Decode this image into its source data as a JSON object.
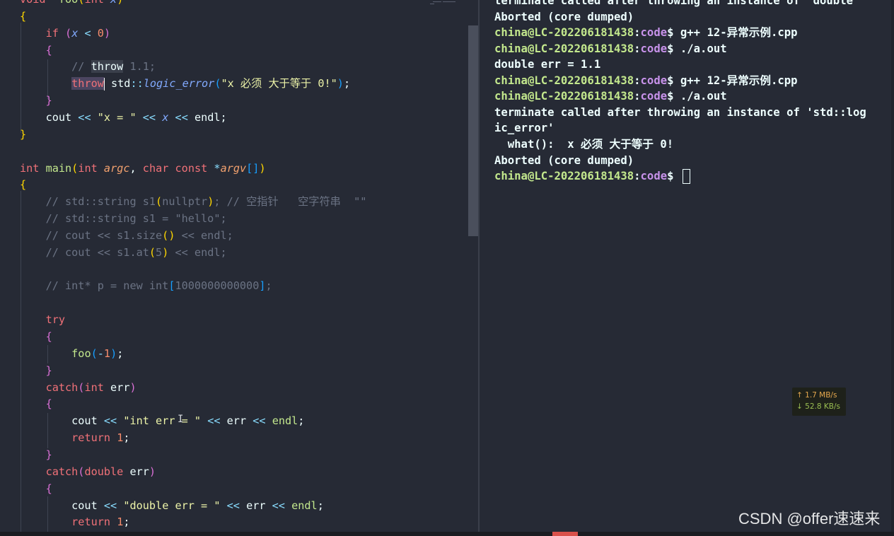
{
  "editor": {
    "lines": [
      {
        "segments": [
          [
            "ty",
            "void"
          ],
          [
            "",
            "  "
          ],
          [
            "fn",
            "foo"
          ],
          [
            "br1",
            "("
          ],
          [
            "ty",
            "int"
          ],
          [
            "",
            ""
          ],
          [
            "it",
            " x"
          ],
          [
            "br1",
            ")"
          ]
        ]
      },
      {
        "segments": [
          [
            "br1",
            "{"
          ]
        ]
      },
      {
        "segments": [
          [
            "",
            "    "
          ],
          [
            "kw",
            "if"
          ],
          [
            "",
            " "
          ],
          [
            "br2",
            "("
          ],
          [
            "it",
            "x"
          ],
          [
            "op",
            " < "
          ],
          [
            "num",
            "0"
          ],
          [
            "br2",
            ")"
          ]
        ]
      },
      {
        "segments": [
          [
            "",
            "    "
          ],
          [
            "br2",
            "{"
          ]
        ]
      },
      {
        "segments": [
          [
            "",
            "        "
          ],
          [
            "cmt",
            "// "
          ],
          [
            "hl",
            "throw"
          ],
          [
            "cmt",
            " 1.1;"
          ]
        ]
      },
      {
        "segments": [
          [
            "",
            "        "
          ],
          [
            "hl2",
            "throw"
          ],
          [
            "cursor",
            ""
          ],
          [
            "",
            " std"
          ],
          [
            "op",
            "::"
          ],
          [
            "it",
            "logic_error"
          ],
          [
            "br3",
            "("
          ],
          [
            "str",
            "\"x 必须 大于等于 0!\""
          ],
          [
            "br3",
            ")"
          ],
          [
            "",
            ";"
          ]
        ]
      },
      {
        "segments": [
          [
            "",
            "    "
          ],
          [
            "br2",
            "}"
          ]
        ]
      },
      {
        "segments": [
          [
            "",
            "    cout "
          ],
          [
            "op",
            "<<"
          ],
          [
            "",
            " "
          ],
          [
            "str",
            "\"x = \""
          ],
          [
            "",
            " "
          ],
          [
            "op",
            "<<"
          ],
          [
            "",
            " "
          ],
          [
            "it",
            "x"
          ],
          [
            "",
            " "
          ],
          [
            "op",
            "<<"
          ],
          [
            "",
            " endl;"
          ]
        ]
      },
      {
        "segments": [
          [
            "br1",
            "}"
          ]
        ]
      },
      {
        "segments": []
      },
      {
        "segments": [
          [
            "ty",
            "int"
          ],
          [
            "",
            " "
          ],
          [
            "fn",
            "main"
          ],
          [
            "br1",
            "("
          ],
          [
            "ty",
            "int"
          ],
          [
            "",
            " "
          ],
          [
            "par",
            "argc"
          ],
          [
            "",
            ", "
          ],
          [
            "ty",
            "char"
          ],
          [
            "",
            " "
          ],
          [
            "ty",
            "const"
          ],
          [
            "",
            " "
          ],
          [
            "op",
            "*"
          ],
          [
            "par",
            "argv"
          ],
          [
            "br3",
            "[]"
          ],
          [
            "br1",
            ")"
          ]
        ]
      },
      {
        "segments": [
          [
            "br1",
            "{"
          ]
        ]
      },
      {
        "segments": [
          [
            "",
            "    "
          ],
          [
            "cmt",
            "// std::string s1"
          ],
          [
            "br1",
            "("
          ],
          [
            "cmt",
            "nullptr"
          ],
          [
            "br1",
            ")"
          ],
          [
            "cmt",
            "; // 空指针   空字符串  \"\""
          ]
        ]
      },
      {
        "segments": [
          [
            "",
            "    "
          ],
          [
            "cmt",
            "// std::string s1 = \"hello\";"
          ]
        ]
      },
      {
        "segments": [
          [
            "",
            "    "
          ],
          [
            "cmt",
            "// cout << s1.size"
          ],
          [
            "br1",
            "()"
          ],
          [
            "cmt",
            " << endl;"
          ]
        ]
      },
      {
        "segments": [
          [
            "",
            "    "
          ],
          [
            "cmt",
            "// cout << s1.at"
          ],
          [
            "br1",
            "("
          ],
          [
            "cmt",
            "5"
          ],
          [
            "br1",
            ")"
          ],
          [
            "cmt",
            " << endl;"
          ]
        ]
      },
      {
        "segments": []
      },
      {
        "segments": [
          [
            "",
            "    "
          ],
          [
            "cmt",
            "// int* p = new int"
          ],
          [
            "br3",
            "["
          ],
          [
            "cmt",
            "1000000000000"
          ],
          [
            "br3",
            "]"
          ],
          [
            "cmt",
            ";"
          ]
        ]
      },
      {
        "segments": []
      },
      {
        "segments": [
          [
            "",
            "    "
          ],
          [
            "kw",
            "try"
          ]
        ]
      },
      {
        "segments": [
          [
            "",
            "    "
          ],
          [
            "br2",
            "{"
          ]
        ]
      },
      {
        "segments": [
          [
            "",
            "        "
          ],
          [
            "fn",
            "foo"
          ],
          [
            "br3",
            "("
          ],
          [
            "op",
            "-"
          ],
          [
            "num",
            "1"
          ],
          [
            "br3",
            ")"
          ],
          [
            "",
            ";"
          ]
        ]
      },
      {
        "segments": [
          [
            "",
            "    "
          ],
          [
            "br2",
            "}"
          ]
        ]
      },
      {
        "segments": [
          [
            "",
            "    "
          ],
          [
            "kw",
            "catch"
          ],
          [
            "br2",
            "("
          ],
          [
            "ty",
            "int"
          ],
          [
            "",
            " err"
          ],
          [
            "br2",
            ")"
          ]
        ]
      },
      {
        "segments": [
          [
            "",
            "    "
          ],
          [
            "br2",
            "{"
          ]
        ]
      },
      {
        "segments": [
          [
            "",
            "        cout "
          ],
          [
            "op",
            "<<"
          ],
          [
            "",
            " "
          ],
          [
            "str",
            "\"int err = \""
          ],
          [
            "",
            " "
          ],
          [
            "op",
            "<<"
          ],
          [
            "",
            " err "
          ],
          [
            "op",
            "<<"
          ],
          [
            "",
            " "
          ],
          [
            "fn",
            "endl"
          ],
          [
            "",
            ";"
          ]
        ]
      },
      {
        "segments": [
          [
            "",
            "        "
          ],
          [
            "kw",
            "return"
          ],
          [
            "",
            " "
          ],
          [
            "num",
            "1"
          ],
          [
            "",
            ";"
          ]
        ]
      },
      {
        "segments": [
          [
            "",
            "    "
          ],
          [
            "br2",
            "}"
          ]
        ]
      },
      {
        "segments": [
          [
            "",
            "    "
          ],
          [
            "kw",
            "catch"
          ],
          [
            "br2",
            "("
          ],
          [
            "ty",
            "double"
          ],
          [
            "",
            " err"
          ],
          [
            "br2",
            ")"
          ]
        ]
      },
      {
        "segments": [
          [
            "",
            "    "
          ],
          [
            "br2",
            "{"
          ]
        ]
      },
      {
        "segments": [
          [
            "",
            "        cout "
          ],
          [
            "op",
            "<<"
          ],
          [
            "",
            " "
          ],
          [
            "str",
            "\"double err = \""
          ],
          [
            "",
            " "
          ],
          [
            "op",
            "<<"
          ],
          [
            "",
            " err "
          ],
          [
            "op",
            "<<"
          ],
          [
            "",
            " "
          ],
          [
            "fn",
            "endl"
          ],
          [
            "",
            ";"
          ]
        ]
      },
      {
        "segments": [
          [
            "",
            "        "
          ],
          [
            "kw",
            "return"
          ],
          [
            "",
            " "
          ],
          [
            "num",
            "1"
          ],
          [
            "",
            ";"
          ]
        ]
      }
    ]
  },
  "terminal": {
    "lines": [
      {
        "type": "text",
        "text": "terminate called after throwing an instance of 'double'"
      },
      {
        "type": "text",
        "text": "Aborted (core dumped)"
      },
      {
        "type": "prompt",
        "user": "china@LC-202206181438",
        "path": "code",
        "cmd": " g++ 12-异常示例.cpp"
      },
      {
        "type": "prompt",
        "user": "china@LC-202206181438",
        "path": "code",
        "cmd": " ./a.out"
      },
      {
        "type": "text",
        "text": "double err = 1.1"
      },
      {
        "type": "prompt",
        "user": "china@LC-202206181438",
        "path": "code",
        "cmd": " g++ 12-异常示例.cpp"
      },
      {
        "type": "prompt",
        "user": "china@LC-202206181438",
        "path": "code",
        "cmd": " ./a.out"
      },
      {
        "type": "text",
        "text": "terminate called after throwing an instance of 'std::log"
      },
      {
        "type": "text",
        "text": "ic_error'"
      },
      {
        "type": "text",
        "text": "  what():  x 必须 大于等于 0!"
      },
      {
        "type": "text",
        "text": "Aborted (core dumped)"
      },
      {
        "type": "prompt",
        "user": "china@LC-202206181438",
        "path": "code",
        "cmd": " ",
        "cursor": true
      }
    ]
  },
  "netspeed": {
    "upload": "↑ 1.7 MB/s",
    "download": "↓ 52.8 KB/s"
  },
  "watermark": {
    "text": "CSDN @offer速速来"
  },
  "colors": {
    "background": "#262a35",
    "prompt_user": "#c3e88d",
    "prompt_path": "#c792ea",
    "accent": "#d9514b"
  }
}
